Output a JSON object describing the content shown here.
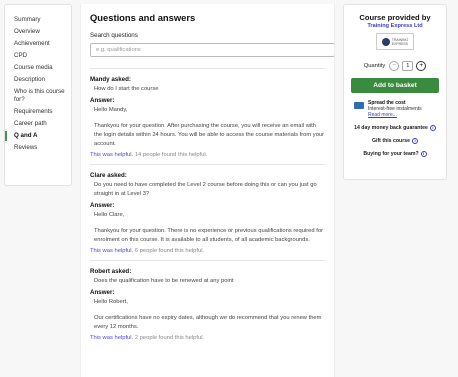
{
  "sidebar": {
    "items": [
      {
        "label": "Summary"
      },
      {
        "label": "Overview"
      },
      {
        "label": "Achievement"
      },
      {
        "label": "CPD"
      },
      {
        "label": "Course media"
      },
      {
        "label": "Description"
      },
      {
        "label": "Who is this course for?"
      },
      {
        "label": "Requirements"
      },
      {
        "label": "Career path"
      },
      {
        "label": "Q and A"
      },
      {
        "label": "Reviews"
      }
    ],
    "active": "Q and A"
  },
  "main": {
    "title": "Questions and answers",
    "search_label": "Search questions",
    "search_placeholder": "e.g. qualifications",
    "questions": [
      {
        "asker": "Mandy asked:",
        "question": "How do I start the course",
        "answer_label": "Answer:",
        "answer": [
          "Hello Mandy,",
          "Thankyou for your question. After purchasing the course, you will receive an email with the login details within 24 hours. You will be able to access the course materials from your account."
        ],
        "helpful_link": "This was helpful.",
        "helpful_count": "14 people found this helpful."
      },
      {
        "asker": "Clare asked:",
        "question": "Do you need to have completed the Level 2 course before doing this or can you just go straight in at Level 3?",
        "answer_label": "Answer:",
        "answer": [
          "Hello Clare,",
          "Thankyou for your question. There is no experience or previous qualifications required for enrolment on this course. It is available to all students, of all academic backgrounds."
        ],
        "helpful_link": "This was helpful.",
        "helpful_count": "6 people found this helpful."
      },
      {
        "asker": "Robert asked:",
        "question": "Does the qualification have to be renewed at any point",
        "answer_label": "Answer:",
        "answer": [
          "Hello Robert,",
          "Our certifications have no expiry dates, although we do recommend that you renew them every 12 months."
        ],
        "helpful_link": "This was helpful.",
        "helpful_count": "2 people found this helpful."
      }
    ]
  },
  "card": {
    "provided_by": "Course provided by",
    "provider_name": "Training Express Ltd",
    "logo_text_1": "TRAINING",
    "logo_text_2": "EXPRESS",
    "quantity_label": "Quantity",
    "quantity_minus": "−",
    "quantity_value": "1",
    "quantity_plus": "+",
    "basket_button": "Add to basket",
    "spread_title": "Spread the cost",
    "spread_sub": "Interest-free instalments",
    "spread_link": "Read more...",
    "guarantee": "14 day money back guarantee",
    "gift": "Gift this course",
    "team": "Buying for your team?",
    "info_glyph": "i",
    "accent_color": "#3a8a3f",
    "link_color": "#3a3ad0"
  }
}
